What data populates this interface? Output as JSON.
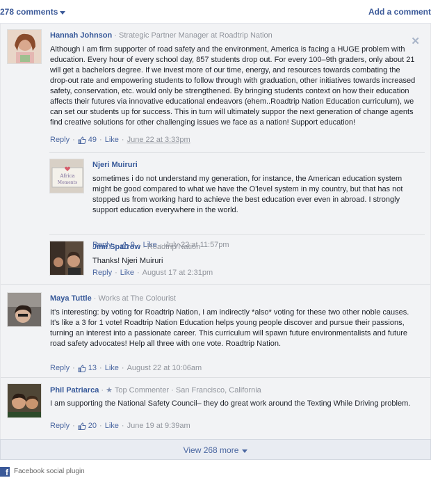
{
  "header": {
    "comment_count": "278 comments",
    "add_comment": "Add a comment"
  },
  "comments": [
    {
      "author": "Hannah Johnson",
      "meta": " · Strategic Partner Manager at Roadtrip Nation",
      "text": "Although I am firm supporter of road safety and the environment, America is facing a HUGE problem with education. Every hour of every school day, 857 students drop out. For every 100–9th graders, only about 21 will get a bachelors degree. If we invest more of our time, energy, and resources towards combating the drop-out rate and empowering students to follow through with graduation, other initiatives towards increased safety, conservation, etc. would only be strengthened. By bringing students context on how their education affects their futures via innovative educational endeavors (ehem..Roadtrip Nation Education curriculum), we can set our students up for success. This in turn will ultimately suppor the next generation of change agents find creative solutions for other challenging issues we face as a nation! Support education!",
      "reply": "Reply",
      "likes": "49",
      "like": "Like",
      "date": "June 22 at 3:33pm"
    },
    {
      "author": "Njeri Muiruri",
      "meta": "",
      "text": "sometimes i do not understand my generation, for instance, the American education system might be good compared to what we have the O'level system in my country, but that has not stopped us from working hard to achieve the best education ever even in abroad. I strongly support education everywhere in the world.",
      "reply": "Reply",
      "likes": "9",
      "like": "Like",
      "date": "July 22 at 11:57pm"
    },
    {
      "author": "Jimi Sparrow",
      "meta": " · Roadtrip Nation",
      "text": "Thanks! Njeri Muiruri",
      "reply": "Reply",
      "like": "Like",
      "date": "August 17 at 2:31pm"
    },
    {
      "author": "Maya Tuttle",
      "meta": " · Works at The Colourist",
      "text": "It's interesting: by voting for Roadtrip Nation, I am indirectly *also* voting for these two other noble causes. It's like a 3 for 1 vote! Roadtrip Nation Education helps young people discover and pursue their passions, turning an interest into a passionate career. This curriculum will spawn future environmentalists and future road safety advocates! Help all three with one vote. Roadtrip Nation.",
      "reply": "Reply",
      "likes": "13",
      "like": "Like",
      "date": "August 22 at 10:06am"
    },
    {
      "author": "Phil Patriarca",
      "meta_star": "★",
      "meta": " Top Commenter · San Francisco, California",
      "text": "I am supporting the National Safety Council– they do great work around the Texting While Driving problem.",
      "reply": "Reply",
      "likes": "20",
      "like": "Like",
      "date": "June 19 at 9:39am"
    }
  ],
  "view_more": "View 268 more",
  "footer": {
    "logo": "f",
    "label": "Facebook social plugin"
  }
}
